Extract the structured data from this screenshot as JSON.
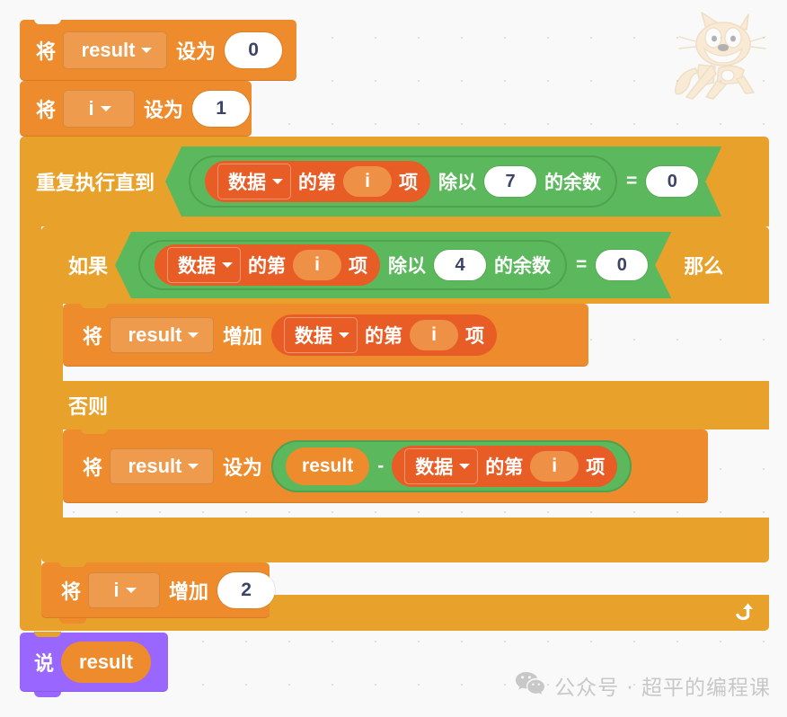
{
  "colors": {
    "variable": "#EE8B2C",
    "variable_dark": "#D9791F",
    "variable_field": "#EF9B4E",
    "control": "#E8A22C",
    "control_dark": "#D08F20",
    "operator": "#5CB85C",
    "operator_dark": "#4EA34E",
    "list": "#E85D26",
    "list_slot": "#EE9147",
    "looks": "#9966FF",
    "looks_oval": "#EE8B2C",
    "canvas_bg": "#F9F9F9",
    "text_white": "#FFFFFF",
    "num_text": "#3D4468",
    "watermark": "#C8C8C8"
  },
  "script": {
    "blocks": [
      {
        "id": "set-result-0",
        "kind": "set-variable",
        "prefix_label": "将",
        "variable": "result",
        "operator_label": "设为",
        "value": "0"
      },
      {
        "id": "set-i-1",
        "kind": "set-variable",
        "prefix_label": "将",
        "variable": "i",
        "operator_label": "设为",
        "value": "1"
      },
      {
        "id": "repeat-until",
        "kind": "repeat-until",
        "label": "重复执行直到",
        "loop_icon": "loop-arrow-icon",
        "condition": {
          "kind": "equals",
          "equals_label": "=",
          "right": "0",
          "left": {
            "kind": "mod",
            "divide_label": "除以",
            "remainder_label": "的余数",
            "divisor": "7",
            "dividend": {
              "kind": "list-item",
              "list": "数据",
              "of_label": "的第",
              "index": "i",
              "item_label": "项"
            }
          }
        }
      },
      {
        "id": "if-else",
        "kind": "if-else",
        "if_label": "如果",
        "then_label": "那么",
        "else_label": "否则",
        "condition": {
          "kind": "equals",
          "equals_label": "=",
          "right": "0",
          "left": {
            "kind": "mod",
            "divide_label": "除以",
            "remainder_label": "的余数",
            "divisor": "4",
            "dividend": {
              "kind": "list-item",
              "list": "数据",
              "of_label": "的第",
              "index": "i",
              "item_label": "项"
            }
          }
        }
      },
      {
        "id": "change-result",
        "kind": "change-variable",
        "prefix_label": "将",
        "variable": "result",
        "operator_label": "增加",
        "value": {
          "kind": "list-item",
          "list": "数据",
          "of_label": "的第",
          "index": "i",
          "item_label": "项"
        }
      },
      {
        "id": "set-result-sub",
        "kind": "set-variable",
        "prefix_label": "将",
        "variable": "result",
        "operator_label": "设为",
        "value": {
          "kind": "subtract",
          "minus_label": "-",
          "left": "result",
          "right": {
            "kind": "list-item",
            "list": "数据",
            "of_label": "的第",
            "index": "i",
            "item_label": "项"
          }
        }
      },
      {
        "id": "change-i",
        "kind": "change-variable",
        "prefix_label": "将",
        "variable": "i",
        "operator_label": "增加",
        "value": "2"
      },
      {
        "id": "say-result",
        "kind": "say",
        "label": "说",
        "value": "result"
      }
    ]
  },
  "watermark": {
    "icon": "wechat-icon",
    "text": "公众号 · 超平的编程课"
  },
  "mascot": {
    "icon": "scratch-cat-icon"
  }
}
